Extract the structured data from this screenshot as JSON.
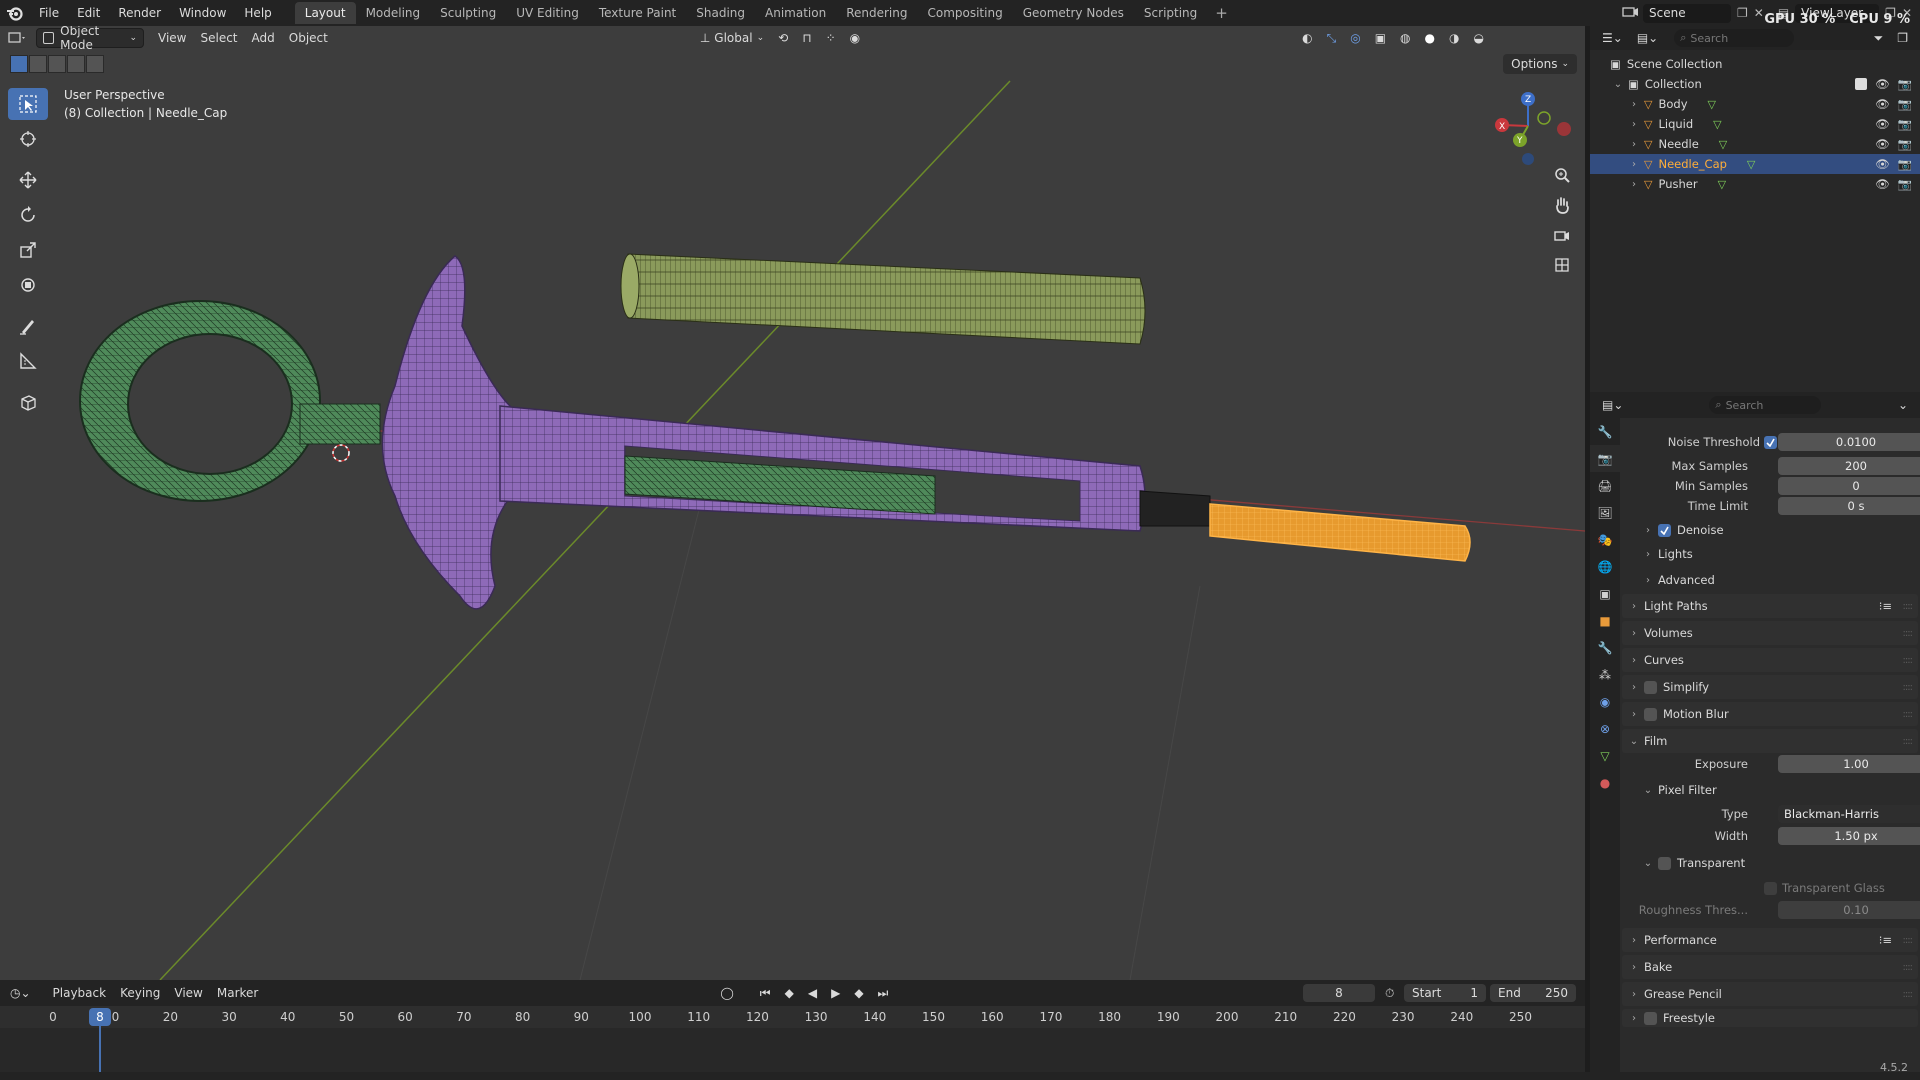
{
  "menu": [
    "File",
    "Edit",
    "Render",
    "Window",
    "Help"
  ],
  "workspaces": [
    "Layout",
    "Modeling",
    "Sculpting",
    "UV Editing",
    "Texture Paint",
    "Shading",
    "Animation",
    "Rendering",
    "Compositing",
    "Geometry Nodes",
    "Scripting"
  ],
  "active_workspace": "Layout",
  "scene": "Scene",
  "view_layer": "ViewLayer",
  "gpu": "GPU 30 %",
  "cpu": "CPU  9 %",
  "viewport": {
    "mode": "Object Mode",
    "menus": [
      "View",
      "Select",
      "Add",
      "Object"
    ],
    "orientation": "Global",
    "options": "Options",
    "perspective": "User Perspective",
    "collection_info": "(8) Collection | Needle_Cap",
    "gizmo": {
      "x": "X",
      "y": "Y",
      "z": "Z"
    }
  },
  "outliner": {
    "search_placeholder": "Search",
    "scene_collection": "Scene Collection",
    "collection": "Collection",
    "objects": [
      "Body",
      "Liquid",
      "Needle",
      "Needle_Cap",
      "Pusher"
    ],
    "selected": "Needle_Cap"
  },
  "properties": {
    "search_placeholder": "Search",
    "noise_threshold_label": "Noise Threshold",
    "noise_threshold": "0.0100",
    "max_samples_label": "Max Samples",
    "max_samples": "200",
    "min_samples_label": "Min Samples",
    "min_samples": "0",
    "time_limit_label": "Time Limit",
    "time_limit": "0 s",
    "denoise": "Denoise",
    "lights": "Lights",
    "advanced": "Advanced",
    "light_paths": "Light Paths",
    "volumes": "Volumes",
    "curves": "Curves",
    "simplify": "Simplify",
    "motion_blur": "Motion Blur",
    "film": "Film",
    "exposure_label": "Exposure",
    "exposure": "1.00",
    "pixel_filter": "Pixel Filter",
    "type_label": "Type",
    "type_value": "Blackman-Harris",
    "width_label": "Width",
    "width_value": "1.50 px",
    "transparent": "Transparent",
    "transparent_glass": "Transparent Glass",
    "roughness_label": "Roughness Thres...",
    "roughness": "0.10",
    "performance": "Performance",
    "bake": "Bake",
    "grease_pencil": "Grease Pencil",
    "freestyle": "Freestyle"
  },
  "timeline": {
    "menus": [
      "Playback",
      "Keying",
      "View",
      "Marker"
    ],
    "current_frame": "8",
    "start_label": "Start",
    "start": "1",
    "end_label": "End",
    "end": "250",
    "ticks": [
      "0",
      "10",
      "20",
      "30",
      "40",
      "50",
      "60",
      "70",
      "80",
      "90",
      "100",
      "110",
      "120",
      "130",
      "140",
      "150",
      "160",
      "170",
      "180",
      "190",
      "200",
      "210",
      "220",
      "230",
      "240",
      "250"
    ]
  },
  "version": "4.5.2",
  "colors": {
    "accent": "#4772b3",
    "selected_object": "#ffae39",
    "cap_mesh": "#8a9a5b",
    "body_mesh": "#8e6ab8",
    "ring_mesh": "#4f8a5a"
  }
}
